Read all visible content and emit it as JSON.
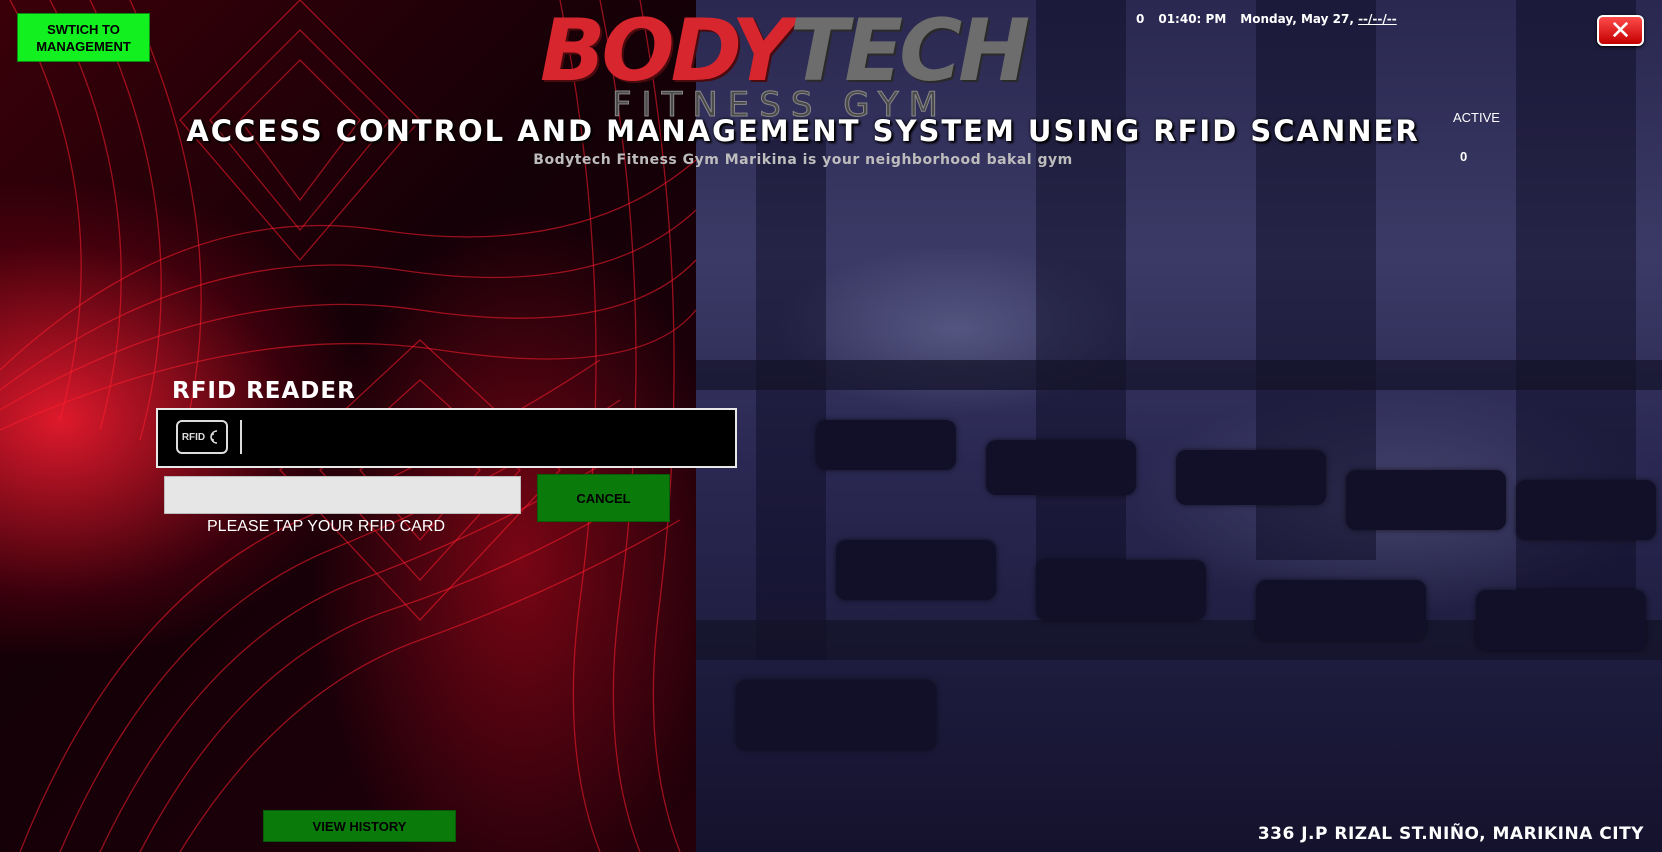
{
  "header": {
    "switch_label": "SWTICH TO MANAGEMENT",
    "logo_primary_a": "BODY",
    "logo_primary_b": "TECH",
    "logo_secondary": "FITNESS GYM",
    "title": "ACCESS CONTROL AND MANAGEMENT SYSTEM USING RFID SCANNER",
    "subtitle": "Bodytech Fitness Gym Marikina is your neighborhood bakal gym"
  },
  "status": {
    "counter": "0",
    "time": "01:40: PM",
    "date": "Monday, May 27,",
    "placeholder_date": "--/--/--",
    "active_label": "ACTIVE",
    "active_count": "0"
  },
  "rfid": {
    "title": "RFID READER",
    "icon_text": "RFID",
    "input_value": "",
    "text_value": "",
    "cancel_label": "CANCEL",
    "message": "PLEASE TAP YOUR RFID CARD"
  },
  "footer": {
    "history_label": "VIEW HISTORY",
    "address": "336 J.P RIZAL ST.NIÑO, MARIKINA CITY"
  },
  "colors": {
    "switch_bg": "#12f01f",
    "button_bg": "#0a7a0a",
    "close_bg": "#e01010",
    "logo_red": "#d8262f",
    "logo_gray": "#6d6d6d"
  },
  "icons": {
    "close": "close-icon",
    "rfid": "rfid-icon"
  }
}
